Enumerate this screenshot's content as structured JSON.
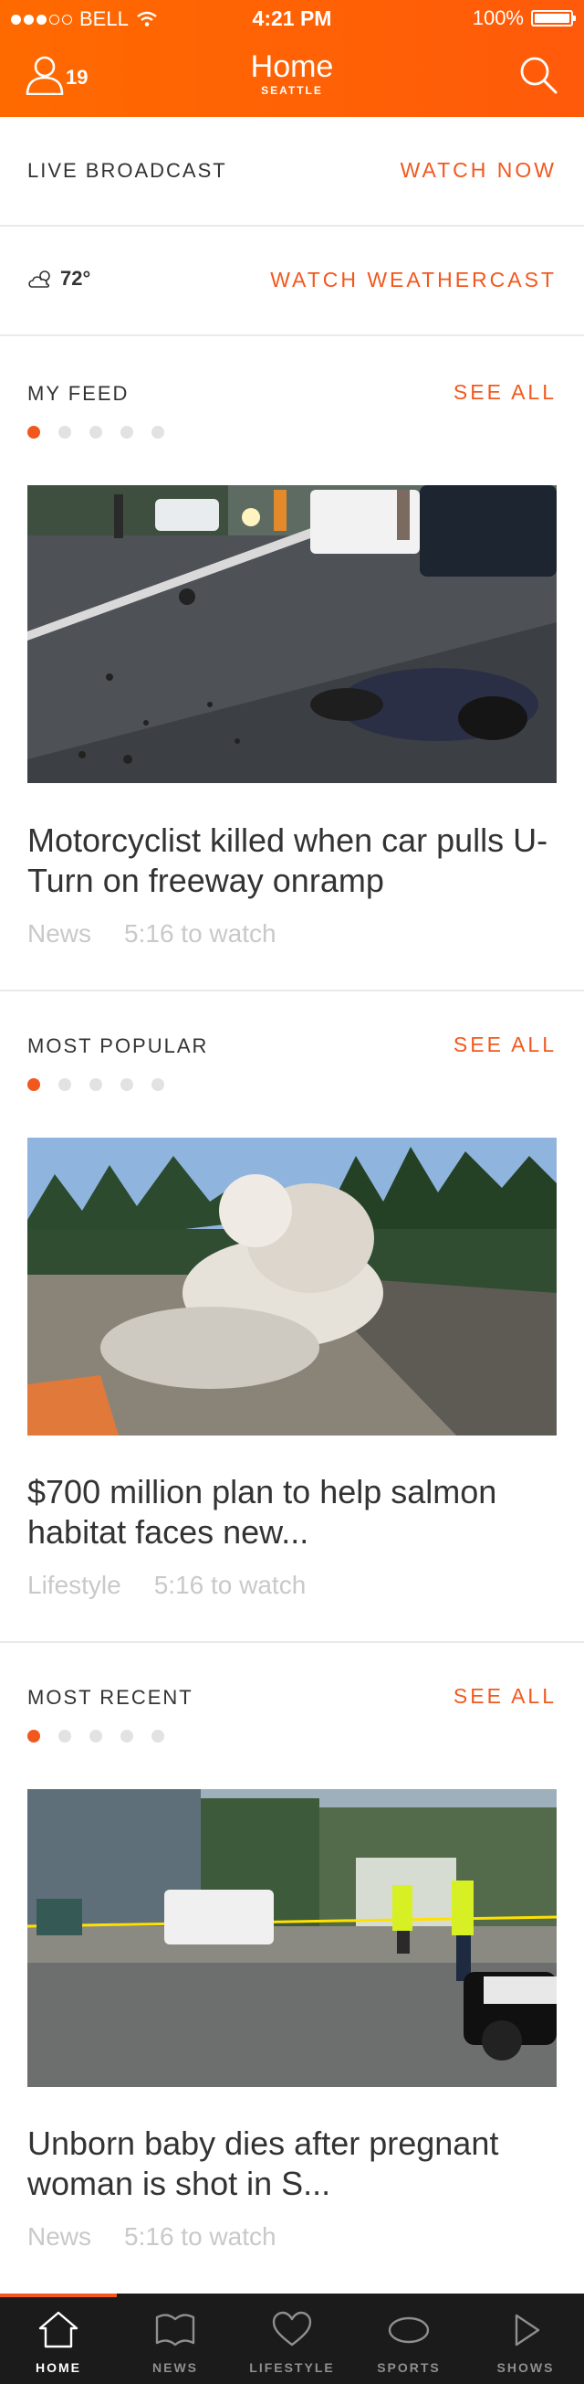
{
  "status_bar": {
    "carrier": "BELL",
    "time": "4:21 PM",
    "battery": "100%"
  },
  "header": {
    "title": "Home",
    "subtitle": "SEATTLE",
    "user_count": "19"
  },
  "live": {
    "label": "LIVE BROADCAST",
    "action": "WATCH NOW"
  },
  "weather": {
    "temp": "72°",
    "action": "WATCH WEATHERCAST"
  },
  "sections": [
    {
      "title": "MY FEED",
      "see_all": "SEE ALL",
      "headline": "Motorcyclist killed when car pulls U-Turn on freeway onramp",
      "category": "News",
      "duration": "5:16 to watch"
    },
    {
      "title": "MOST POPULAR",
      "see_all": "SEE ALL",
      "headline": "$700 million plan to help salmon habitat faces new...",
      "category": "Lifestyle",
      "duration": "5:16 to watch"
    },
    {
      "title": "MOST RECENT",
      "see_all": "SEE ALL",
      "headline": "Unborn baby dies after pregnant woman is shot in S...",
      "category": "News",
      "duration": "5:16 to watch"
    }
  ],
  "tabs": [
    {
      "label": "HOME",
      "icon": "home-icon",
      "active": true
    },
    {
      "label": "NEWS",
      "icon": "news-icon"
    },
    {
      "label": "LIFESTYLE",
      "icon": "heart-icon"
    },
    {
      "label": "SPORTS",
      "icon": "football-icon"
    },
    {
      "label": "SHOWS",
      "icon": "play-icon"
    }
  ],
  "colors": {
    "brand": "#ff6a00",
    "accent": "#f2581e",
    "tabbar": "#1b1b1b",
    "muted": "#c9c9c9"
  }
}
